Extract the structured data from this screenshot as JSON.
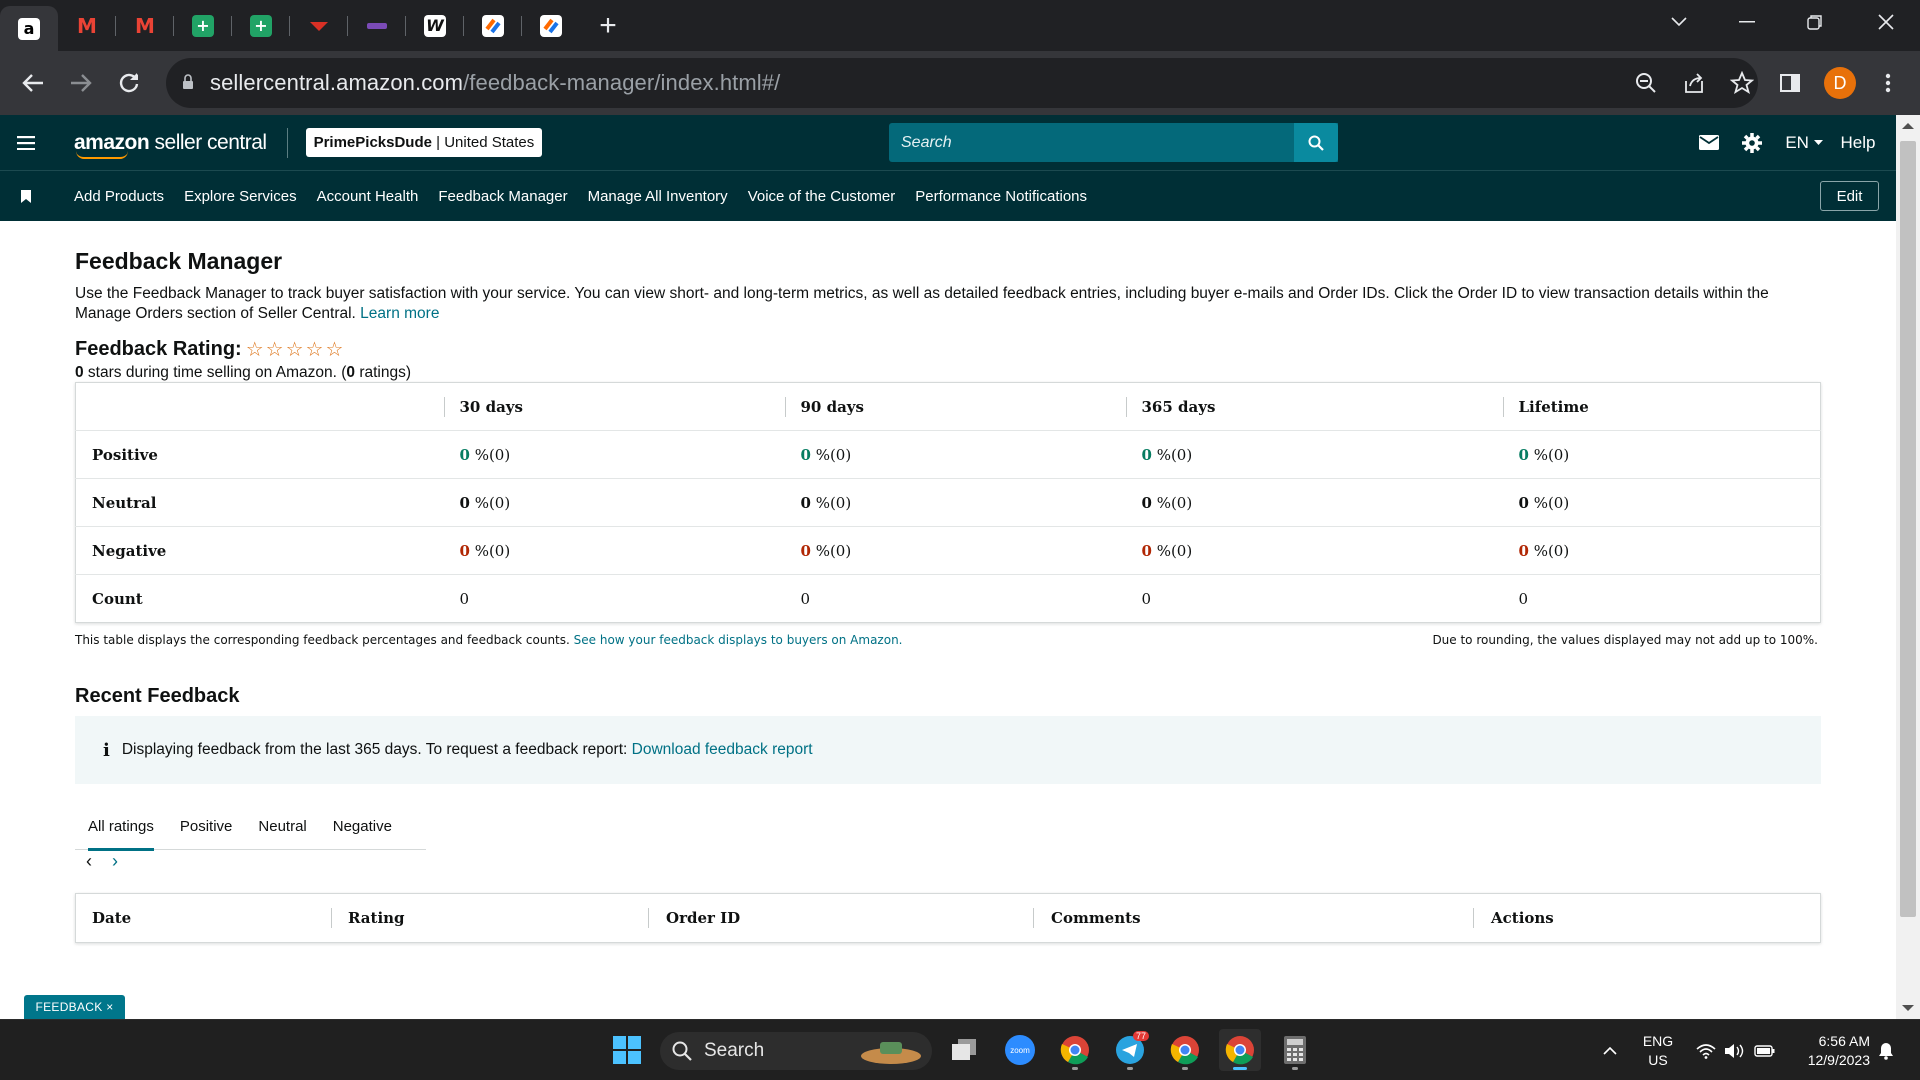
{
  "browser": {
    "url_host": "sellercentral.amazon.com",
    "url_path": "/feedback-manager/index.html#/",
    "profile_initial": "D",
    "new_tab_symbol": "+"
  },
  "header": {
    "logo_bold": "amazon",
    "logo_text": " seller central",
    "store_name": "PrimePicksDude",
    "marketplace": "United States",
    "search_placeholder": "Search",
    "language": "EN",
    "help": "Help"
  },
  "nav": {
    "items": [
      "Add Products",
      "Explore Services",
      "Account Health",
      "Feedback Manager",
      "Manage All Inventory",
      "Voice of the Customer",
      "Performance Notifications"
    ],
    "edit": "Edit"
  },
  "page": {
    "title": "Feedback Manager",
    "description": "Use the Feedback Manager to track buyer satisfaction with your service. You can view short- and long-term metrics, as well as detailed feedback entries, including buyer e-mails and Order IDs. Click the Order ID to view transaction details within the Manage Orders section of Seller Central.",
    "learn_more": "Learn more",
    "rating_label": "Feedback Rating:",
    "stars_filled": 0,
    "stars_total": 5,
    "stars_count": "0",
    "stars_text": " stars during time selling on Amazon. (",
    "ratings_count": "0",
    "ratings_text": " ratings)"
  },
  "feedback_table": {
    "columns": [
      "30 days",
      "90 days",
      "365 days",
      "Lifetime"
    ],
    "rows": [
      {
        "label": "Positive",
        "cells": [
          [
            "0",
            " %(0)"
          ],
          [
            "0",
            " %(0)"
          ],
          [
            "0",
            " %(0)"
          ],
          [
            "0",
            " %(0)"
          ]
        ]
      },
      {
        "label": "Neutral",
        "cells": [
          [
            "0",
            " %(0)"
          ],
          [
            "0",
            " %(0)"
          ],
          [
            "0",
            " %(0)"
          ],
          [
            "0",
            " %(0)"
          ]
        ]
      },
      {
        "label": "Negative",
        "cells": [
          [
            "0",
            " %(0)"
          ],
          [
            "0",
            " %(0)"
          ],
          [
            "0",
            " %(0)"
          ],
          [
            "0",
            " %(0)"
          ]
        ]
      },
      {
        "label": "Count",
        "cells": [
          [
            "0",
            ""
          ],
          [
            "0",
            ""
          ],
          [
            "0",
            ""
          ],
          [
            "0",
            ""
          ]
        ]
      }
    ],
    "note": "This table displays the corresponding feedback percentages and feedback counts.",
    "note_link": "See how your feedback displays to buyers on Amazon.",
    "rounding_note": "Due to rounding, the values displayed may not add up to 100%."
  },
  "recent": {
    "title": "Recent Feedback",
    "info_text": "Displaying feedback from the last 365 days. To request a feedback report:",
    "info_link": "Download feedback report",
    "tabs": [
      "All ratings",
      "Positive",
      "Neutral",
      "Negative"
    ],
    "active_tab": "All ratings",
    "columns": [
      "Date",
      "Rating",
      "Order ID",
      "Comments",
      "Actions"
    ]
  },
  "feedback_widget": "FEEDBACK",
  "taskbar": {
    "search": "Search",
    "language": "ENG",
    "region": "US",
    "time": "6:56 AM",
    "date": "12/9/2023",
    "telegram_badge": "77"
  },
  "colors": {
    "header_bg": "#002f36",
    "search_bg": "#04697a",
    "link": "#007185",
    "positive": "#067d62",
    "negative": "#b12704"
  }
}
